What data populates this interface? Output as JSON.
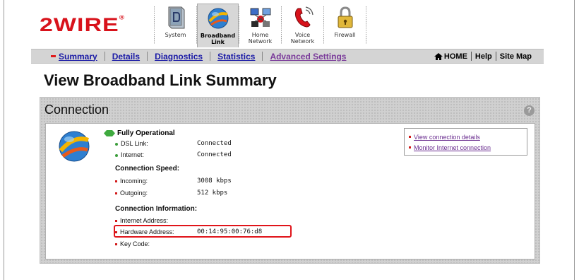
{
  "brand": {
    "logo": "2WIRE",
    "reg": "®"
  },
  "tabs": [
    {
      "label1": "System",
      "label2": "",
      "icon": "system-icon",
      "active": false
    },
    {
      "label1": "Broadband",
      "label2": "Link",
      "icon": "globe-icon",
      "active": true
    },
    {
      "label1": "Home",
      "label2": "Network",
      "icon": "home-network-icon",
      "active": false
    },
    {
      "label1": "Voice",
      "label2": "Network",
      "icon": "phone-icon",
      "active": false
    },
    {
      "label1": "Firewall",
      "label2": "",
      "icon": "padlock-icon",
      "active": false
    }
  ],
  "subnav": {
    "items": [
      "Summary",
      "Details",
      "Diagnostics",
      "Statistics",
      "Advanced Settings"
    ],
    "home": "HOME",
    "help": "Help",
    "sitemap": "Site Map"
  },
  "page": {
    "title": "View Broadband Link Summary"
  },
  "panel": {
    "title": "Connection",
    "help": "?",
    "status": "Fully Operational",
    "status_rows": [
      {
        "key": "DSL Link:",
        "value": "Connected"
      },
      {
        "key": "Internet:",
        "value": "Connected"
      }
    ],
    "speed_head": "Connection Speed:",
    "speed_rows": [
      {
        "key": "Incoming:",
        "value": "3008 kbps"
      },
      {
        "key": "Outgoing:",
        "value": "512 kbps"
      }
    ],
    "info_head": "Connection Information:",
    "info_rows": [
      {
        "key": "Internet Address:",
        "value": ""
      },
      {
        "key": "Hardware Address:",
        "value": "00:14:95:00:76:d8"
      },
      {
        "key": "Key Code:",
        "value": ""
      }
    ],
    "links": [
      "View connection details",
      "Monitor Internet connection"
    ]
  },
  "colors": {
    "brand_red": "#d8121b",
    "link_blue": "#1a1aa6",
    "link_purple": "#6a2d8f",
    "highlight_red": "#e0141a"
  }
}
